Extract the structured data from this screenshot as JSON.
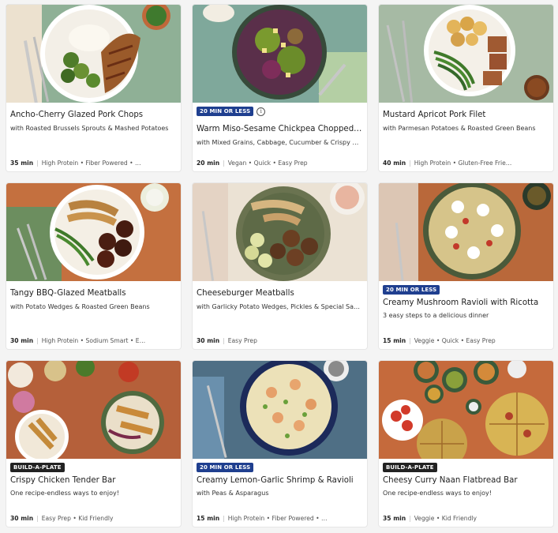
{
  "cards": [
    {
      "title": "Ancho-Cherry Glazed Pork Chops",
      "subtitle": "with Roasted Brussels Sprouts & Mashed Potatoes",
      "time": "35 min",
      "tags": "High Protein • Fiber Powered • …",
      "badge": ""
    },
    {
      "title": "Warm Miso-Sesame Chickpea Chopped …",
      "subtitle": "with Mixed Grains, Cabbage, Cucumber & Crispy Wo…",
      "time": "20 min",
      "tags": "Vegan • Quick • Easy Prep",
      "badge": "20 MIN OR LESS",
      "info": "i"
    },
    {
      "title": "Mustard Apricot Pork Filet",
      "subtitle": "with Parmesan Potatoes & Roasted Green Beans",
      "time": "40 min",
      "tags": "High Protein • Gluten-Free Frie…",
      "badge": ""
    },
    {
      "title": "Tangy BBQ-Glazed Meatballs",
      "subtitle": "with Potato Wedges & Roasted Green Beans",
      "time": "30 min",
      "tags": "High Protein • Sodium Smart • E…",
      "badge": ""
    },
    {
      "title": "Cheeseburger Meatballs",
      "subtitle": "with Garlicky Potato Wedges, Pickles & Special Sauce",
      "time": "30 min",
      "tags": "Easy Prep",
      "badge": ""
    },
    {
      "title": "Creamy Mushroom Ravioli with Ricotta",
      "subtitle": "3 easy steps to a delicious dinner",
      "time": "15 min",
      "tags": "Veggie • Quick • Easy Prep",
      "badge": "20 MIN OR LESS"
    },
    {
      "title": "Crispy Chicken Tender Bar",
      "subtitle": "One recipe-endless ways to enjoy!",
      "time": "30 min",
      "tags": "Easy Prep • Kid Friendly",
      "badge": "BUILD-A-PLATE"
    },
    {
      "title": "Creamy Lemon-Garlic Shrimp & Ravioli",
      "subtitle": "with Peas & Asparagus",
      "time": "15 min",
      "tags": "High Protein • Fiber Powered • …",
      "badge": "20 MIN OR LESS"
    },
    {
      "title": "Cheesy Curry Naan Flatbread Bar",
      "subtitle": "One recipe-endless ways to enjoy!",
      "time": "35 min",
      "tags": "Veggie • Kid Friendly",
      "badge": "BUILD-A-PLATE"
    }
  ],
  "colors": {
    "time_badge": "#1f3f8f",
    "build_badge": "#222222",
    "card_bg": "#ffffff",
    "page_bg": "#f4f4f4"
  }
}
